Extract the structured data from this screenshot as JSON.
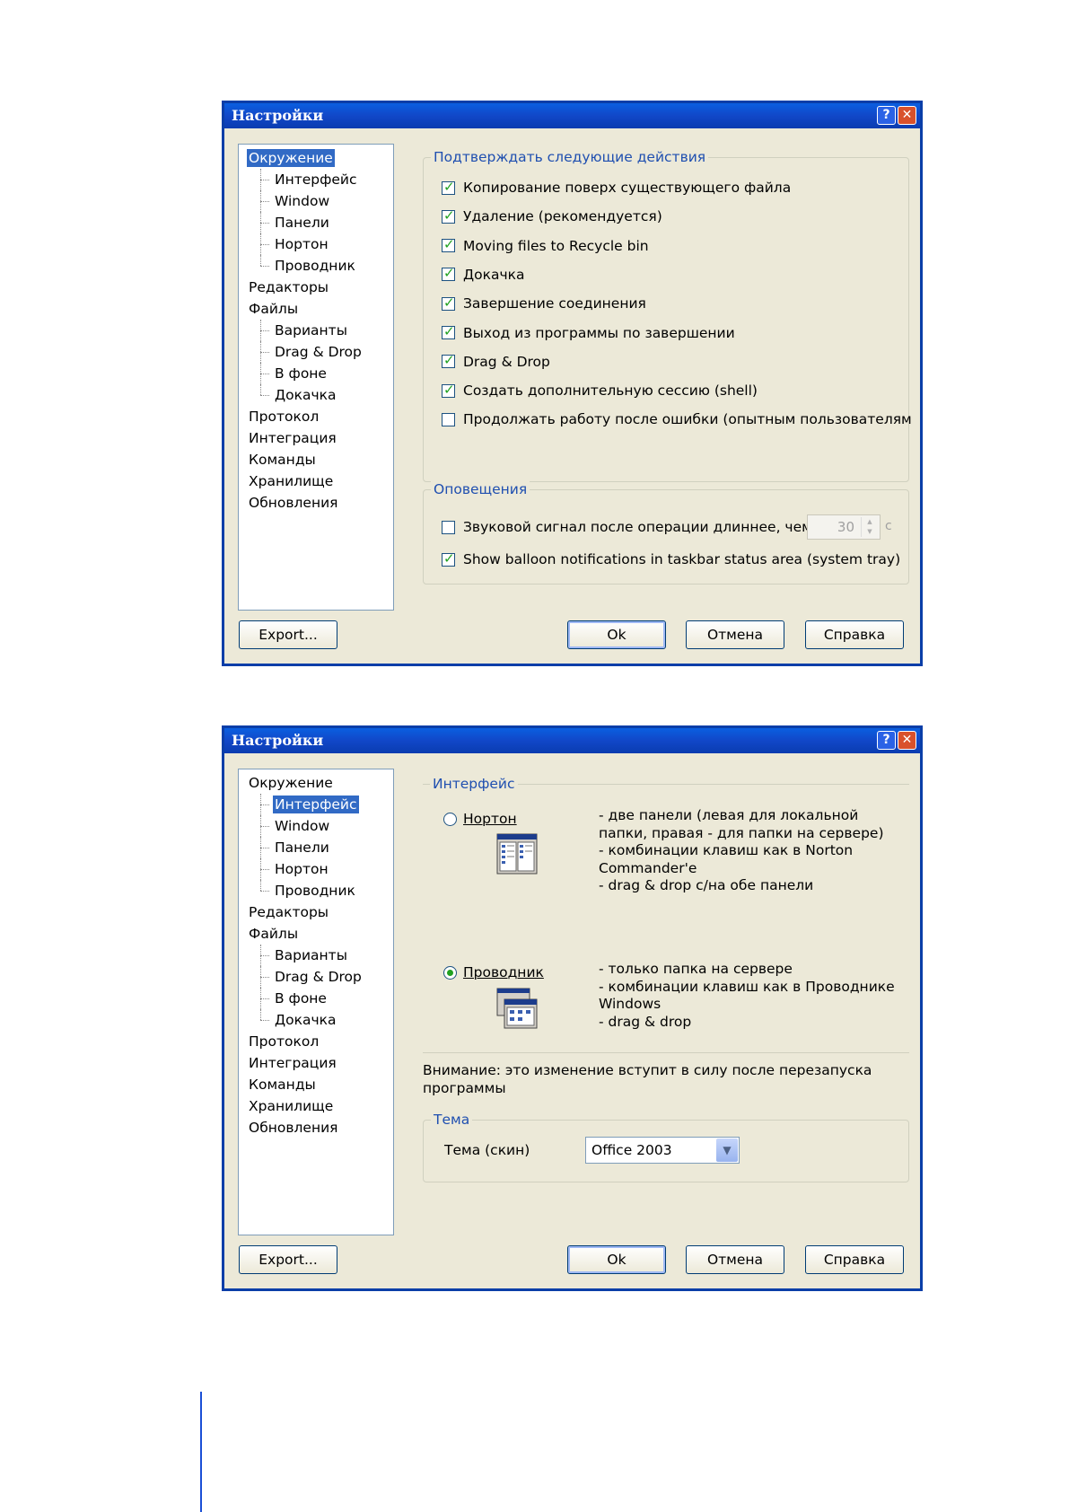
{
  "tree_items": [
    {
      "label": "Окружение",
      "level": 0
    },
    {
      "label": "Интерфейс",
      "level": 1
    },
    {
      "label": "Window",
      "level": 1
    },
    {
      "label": "Панели",
      "level": 1
    },
    {
      "label": "Нортон",
      "level": 1
    },
    {
      "label": "Проводник",
      "level": 1,
      "last": true
    },
    {
      "label": "Редакторы",
      "level": 0
    },
    {
      "label": "Файлы",
      "level": 0
    },
    {
      "label": "Варианты",
      "level": 1
    },
    {
      "label": "Drag & Drop",
      "level": 1
    },
    {
      "label": "В фоне",
      "level": 1
    },
    {
      "label": "Докачка",
      "level": 1,
      "last": true
    },
    {
      "label": "Протокол",
      "level": 0
    },
    {
      "label": "Интеграция",
      "level": 0
    },
    {
      "label": "Команды",
      "level": 0
    },
    {
      "label": "Хранилище",
      "level": 0
    },
    {
      "label": "Обновления",
      "level": 0
    }
  ],
  "dialog1": {
    "title": "Настройки",
    "help_btn": "?",
    "close_btn": "✕",
    "selected_tree_index": 0,
    "confirm_group_title": "Подтверждать следующие действия",
    "confirm_items": [
      {
        "label": "Копирование поверх существующего файла",
        "checked": true
      },
      {
        "label": "Удаление (рекомендуется)",
        "checked": true
      },
      {
        "label": "Moving files to Recycle bin",
        "checked": true
      },
      {
        "label": "Докачка",
        "checked": true
      },
      {
        "label": "Завершение соединения",
        "checked": true
      },
      {
        "label": "Выход из программы по завершении",
        "checked": true
      },
      {
        "label": "Drag & Drop",
        "checked": true
      },
      {
        "label": "Создать дополнительную сессию (shell)",
        "checked": true
      },
      {
        "label": "Продолжать работу после ошибки (опытным пользователям",
        "checked": false
      }
    ],
    "notify_group_title": "Оповещения",
    "sound_label": "Звуковой сигнал после операции длиннее, чем",
    "sound_checked": false,
    "sound_value": "30",
    "sound_unit": "с",
    "balloon_label": "Show balloon notifications in taskbar status area (system tray)",
    "balloon_checked": true,
    "export_btn": "Export...",
    "ok_btn": "Ok",
    "cancel_btn": "Отмена",
    "help_text_btn": "Справка"
  },
  "dialog2": {
    "title": "Настройки",
    "help_btn": "?",
    "close_btn": "✕",
    "selected_tree_index": 1,
    "interface_group_title": "Интерфейс",
    "radio_norton_label": "Нортон",
    "radio_norton_checked": false,
    "norton_desc": "- две панели (левая для локальной папки, правая - для папки на сервере)\n- комбинации клавиш как в Norton Commander'е\n- drag & drop с/на обе панели",
    "radio_explorer_label": "Проводник",
    "radio_explorer_checked": true,
    "explorer_desc": "- только папка на сервере\n- комбинации клавиш как в Проводнике Windows\n- drag & drop",
    "warning_text": "Внимание: это изменение вступит в силу после перезапуска программы",
    "theme_group_title": "Тема",
    "theme_label": "Тема (скин)",
    "theme_value": "Office 2003",
    "export_btn": "Export...",
    "ok_btn": "Ok",
    "cancel_btn": "Отмена",
    "help_text_btn": "Справка"
  },
  "colors": {
    "titlebar": "#0a5fe0",
    "dialog_bg": "#ece9d8",
    "selection": "#316ac5",
    "group_title": "#1f4fb0"
  }
}
